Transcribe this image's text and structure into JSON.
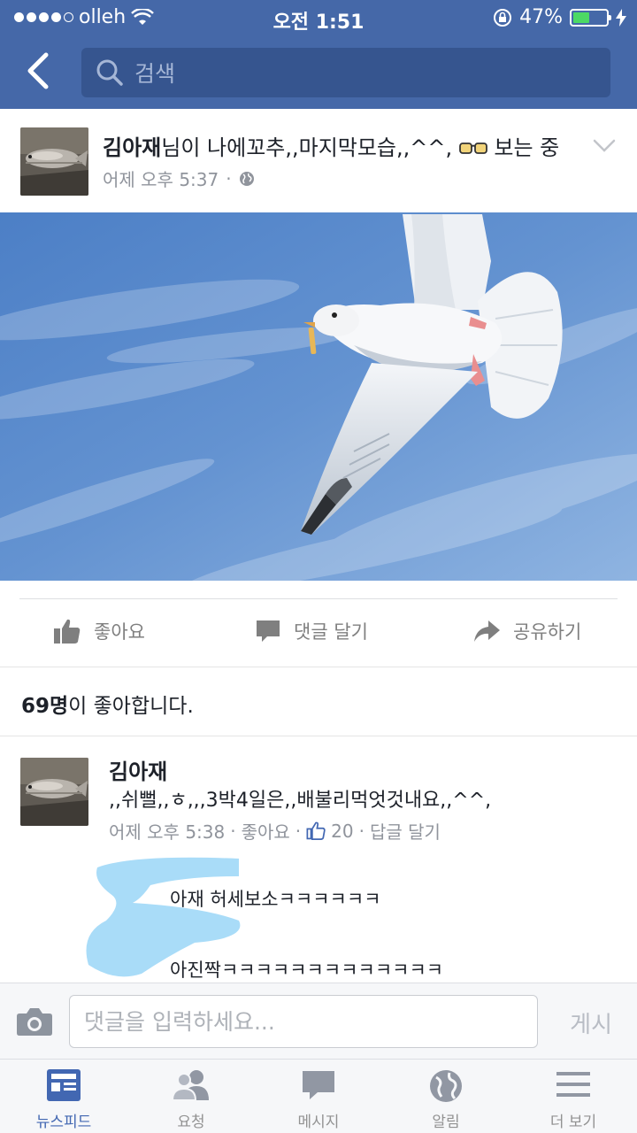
{
  "status_bar": {
    "carrier": "olleh",
    "time": "오전 1:51",
    "battery": "47%",
    "battery_level": 0.47
  },
  "nav": {
    "search_placeholder": "검색"
  },
  "post": {
    "author": "김아재",
    "headline_rest": "님이 나에꼬추,,마지막모습,,^^, ",
    "activity": " 보는 중",
    "time": "어제 오후 5:37",
    "dot": "·"
  },
  "actions": {
    "like": "좋아요",
    "comment": "댓글 달기",
    "share": "공유하기"
  },
  "likes": {
    "count": "69명",
    "suffix": "이 좋아합니다."
  },
  "comment": {
    "author": "김아재",
    "text": ",,쉬뻘,,ㅎ,,,3박4일은,,배불리먹엇것내요,,^^,",
    "time": "어제 오후 5:38",
    "like_link": "좋아요",
    "like_count": "20",
    "reply_link": "답글 달기",
    "dot": "·"
  },
  "replies": [
    {
      "text": "아재 허세보소ㅋㅋㅋㅋㅋㅋ"
    },
    {
      "text": "아진짝ㅋㅋㅋㅋㅋㅋㅋㅋㅋㅋㅋㅋㅋ"
    }
  ],
  "input_bar": {
    "placeholder": "댓글을 입력하세요...",
    "post_label": "게시"
  },
  "tabs": [
    {
      "label": "뉴스피드",
      "icon": "news-feed-icon",
      "active": true
    },
    {
      "label": "요청",
      "icon": "friend-requests-icon"
    },
    {
      "label": "메시지",
      "icon": "messages-icon"
    },
    {
      "label": "알림",
      "icon": "globe-notifications-icon"
    },
    {
      "label": "더 보기",
      "icon": "menu-icon"
    }
  ],
  "colors": {
    "brand_blue": "#4568a8",
    "search_bg": "#36558f",
    "active_tab": "#4267b2",
    "battery_green": "#4cd964"
  }
}
